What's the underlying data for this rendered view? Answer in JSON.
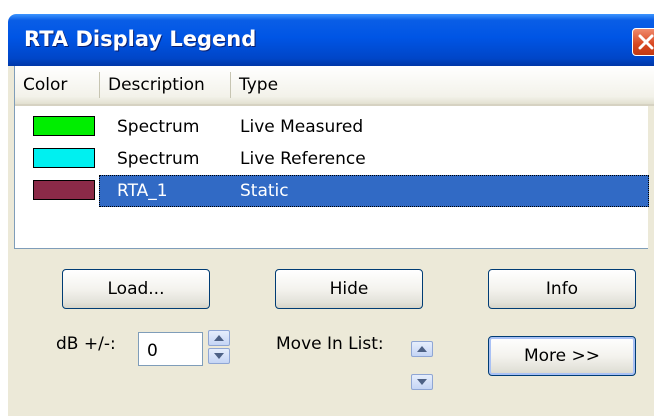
{
  "window": {
    "title": "RTA Display Legend"
  },
  "list": {
    "columns": [
      "Color",
      "Description",
      "Type"
    ],
    "rows": [
      {
        "color": "#00ee00",
        "description": "Spectrum",
        "type": "Live Measured",
        "selected": false
      },
      {
        "color": "#00f0f0",
        "description": "Spectrum",
        "type": "Live Reference",
        "selected": false
      },
      {
        "color": "#8b2a48",
        "description": "RTA_1",
        "type": "Static",
        "selected": true
      }
    ]
  },
  "buttons": {
    "load": "Load...",
    "hide": "Hide",
    "info": "Info",
    "more": "More >>"
  },
  "db": {
    "label": "dB +/-:",
    "value": "0"
  },
  "move": {
    "label": "Move In List:"
  },
  "colors": {
    "titlebar": "#0055e5",
    "selection": "#316ac5",
    "face": "#ece9d8"
  }
}
